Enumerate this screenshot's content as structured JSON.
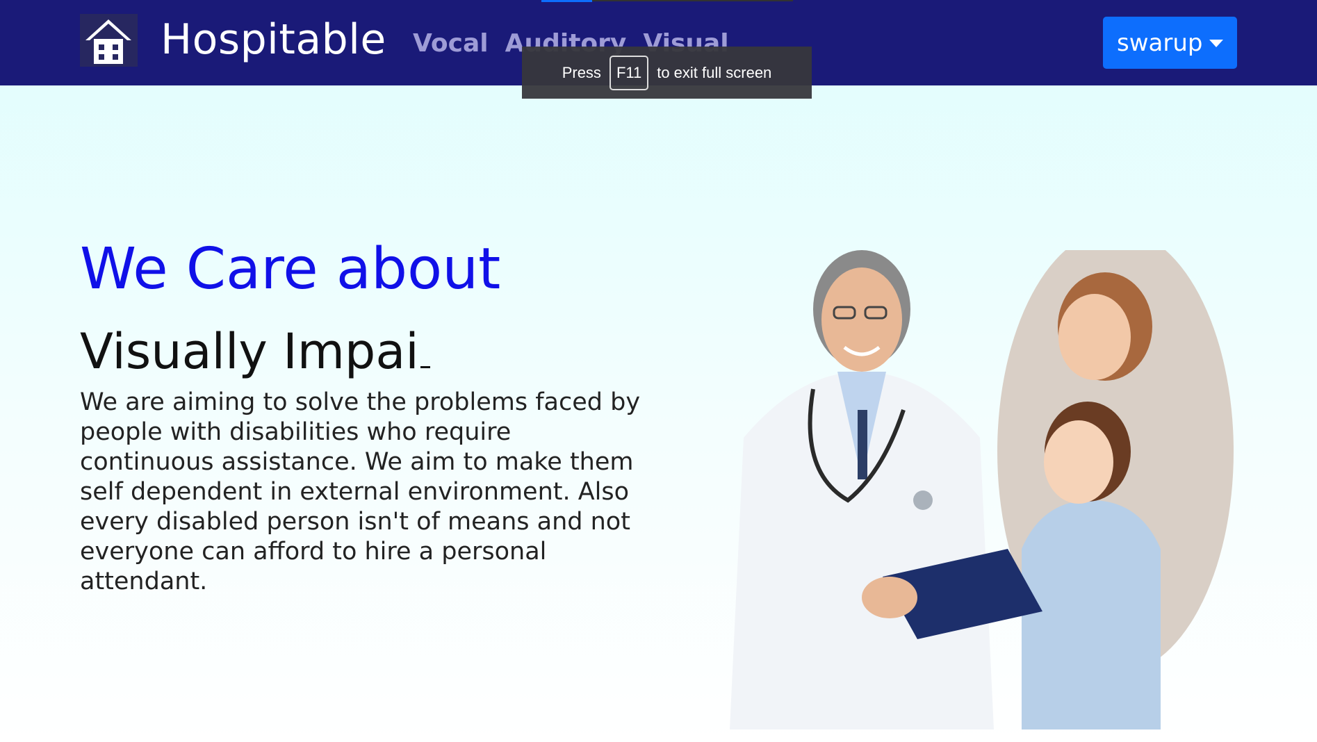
{
  "navbar": {
    "brand": "Hospitable",
    "links": [
      "Vocal",
      "Auditory",
      "Visual"
    ],
    "user": "swarup",
    "logo_icon": "hospital-icon",
    "background": "#1a1a78"
  },
  "fullscreen_toast": {
    "prefix": "Press",
    "key": "F11",
    "suffix": "to exit full screen"
  },
  "hero": {
    "title": "We Care about",
    "typed_text": "Visually Impai",
    "description": "We are aiming to solve the problems faced by people with disabilities who require continuous assistance. We aim to make them self dependent in external environment. Also every disabled person isn't of means and not everyone can afford to hire a personal attendant.",
    "title_color": "#1010e8",
    "image": "doctor-with-mother-and-child"
  }
}
